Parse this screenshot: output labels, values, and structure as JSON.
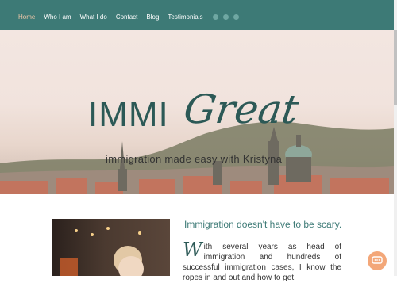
{
  "nav": {
    "items": [
      "Home",
      "Who I am",
      "What I do",
      "Contact",
      "Blog",
      "Testimonials"
    ],
    "social": [
      "facebook-icon",
      "instagram-icon",
      "linkedin-icon"
    ],
    "bg_color": "#3d7a76",
    "active_color": "#f2c7a8"
  },
  "hero": {
    "brand_left": "IMMI",
    "brand_right": "Great",
    "tagline": "immigration made easy with Kristyna"
  },
  "intro": {
    "title": "Immigration doesn't have to be scary.",
    "dropcap": "W",
    "text_line1": "ith several years as head of immigration",
    "text_line2": "and hundreds of successful immigration cases,",
    "text_line3": "I know the ropes in and out and how to get"
  },
  "chat_icon": "chat-bubble-icon"
}
